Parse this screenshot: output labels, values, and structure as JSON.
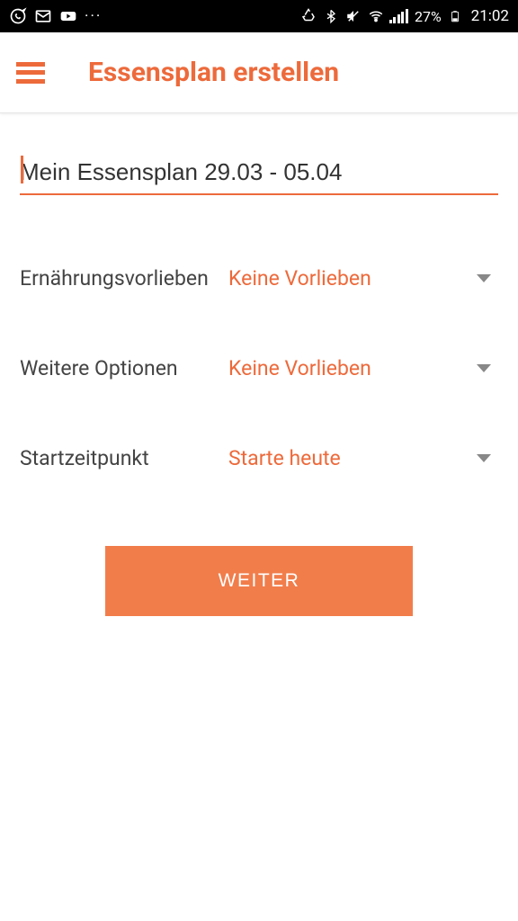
{
  "status": {
    "battery": "27%",
    "time": "21:02"
  },
  "header": {
    "title": "Essensplan erstellen"
  },
  "form": {
    "plan_name": "Mein Essensplan 29.03 - 05.04",
    "options": [
      {
        "label": "Ernährungsvorlieben",
        "value": "Keine Vorlieben"
      },
      {
        "label": "Weitere Optionen",
        "value": "Keine Vorlieben"
      },
      {
        "label": "Startzeitpunkt",
        "value": "Starte heute"
      }
    ],
    "continue_label": "WEITER"
  }
}
